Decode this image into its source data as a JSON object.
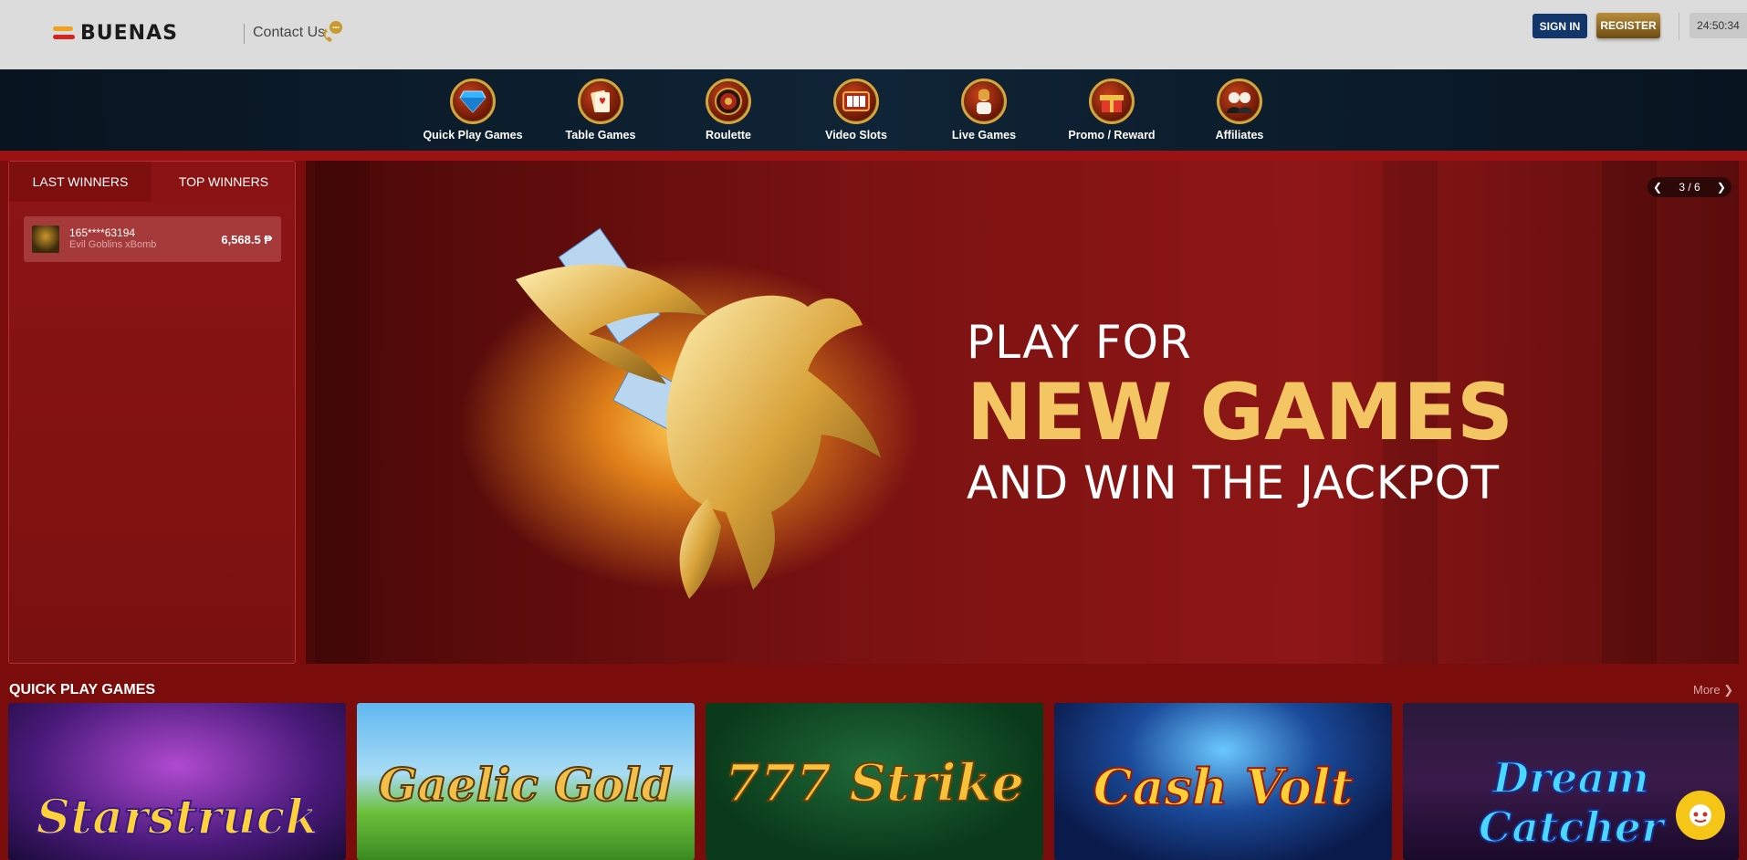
{
  "header": {
    "logo_text": "BUENAS",
    "contact_label": "Contact Us",
    "signin_label": "SIGN IN",
    "register_label": "REGISTER",
    "clock": "24:50:34"
  },
  "nav": {
    "items": [
      {
        "label": "Quick Play Games",
        "icon": "diamond-icon"
      },
      {
        "label": "Table Games",
        "icon": "cards-icon"
      },
      {
        "label": "Roulette",
        "icon": "roulette-icon"
      },
      {
        "label": "Video Slots",
        "icon": "slot-machine-icon"
      },
      {
        "label": "Live Games",
        "icon": "live-dealer-icon"
      },
      {
        "label": "Promo / Reward",
        "icon": "gift-icon"
      },
      {
        "label": "Affiliates",
        "icon": "affiliates-icon"
      }
    ]
  },
  "winners": {
    "tab_last": "LAST WINNERS",
    "tab_top": "TOP WINNERS",
    "active_tab": "TOP WINNERS",
    "rows": [
      {
        "user": "165****63194",
        "game": "Evil Goblins xBomb",
        "amount": "6,568.5 ₱"
      }
    ]
  },
  "hero": {
    "line1": "PLAY FOR",
    "line2": "NEW GAMES",
    "line3": "AND WIN THE JACKPOT",
    "counter": "3 / 6"
  },
  "quick_play": {
    "title": "QUICK PLAY GAMES",
    "more_label": "More",
    "games": [
      {
        "title": "Starstruck"
      },
      {
        "title": "Gaelic Gold"
      },
      {
        "title": "777 Strike"
      },
      {
        "title": "Cash Volt"
      },
      {
        "title": "Dream Catcher"
      }
    ]
  },
  "colors": {
    "header_bg": "#dcdcdc",
    "nav_bg": "#0f2436",
    "page_bg": "#7a0c0c",
    "signin_bg": "#12356c",
    "register_bg": "#8f6a24",
    "accent_gold": "#f3c663"
  }
}
